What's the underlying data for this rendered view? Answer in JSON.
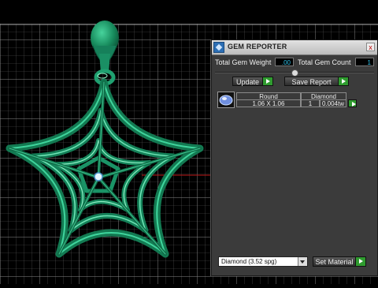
{
  "panel": {
    "title": "GEM REPORTER",
    "close_glyph": "x",
    "total_gem_weight_label": "Total Gem Weight",
    "total_gem_weight_value": ".00",
    "total_gem_count_label": "Total Gem Count",
    "total_gem_count_value": "1",
    "update_label": "Update",
    "save_report_label": "Save Report"
  },
  "gem_table": {
    "columns": [
      "Round",
      "Diamond"
    ],
    "rows": [
      {
        "size": "1.06 X 1.06",
        "count": "1",
        "weight": "0.004tw"
      }
    ]
  },
  "material": {
    "selected": "Diamond     (3.52 spg)",
    "set_material_label": "Set Material"
  },
  "colors": {
    "jewelry": "#1c8f62",
    "highlight": "#8df0c4",
    "grid": "#7a7a7a",
    "value_text": "#34c8f0",
    "go_button": "#2f9b2f"
  }
}
